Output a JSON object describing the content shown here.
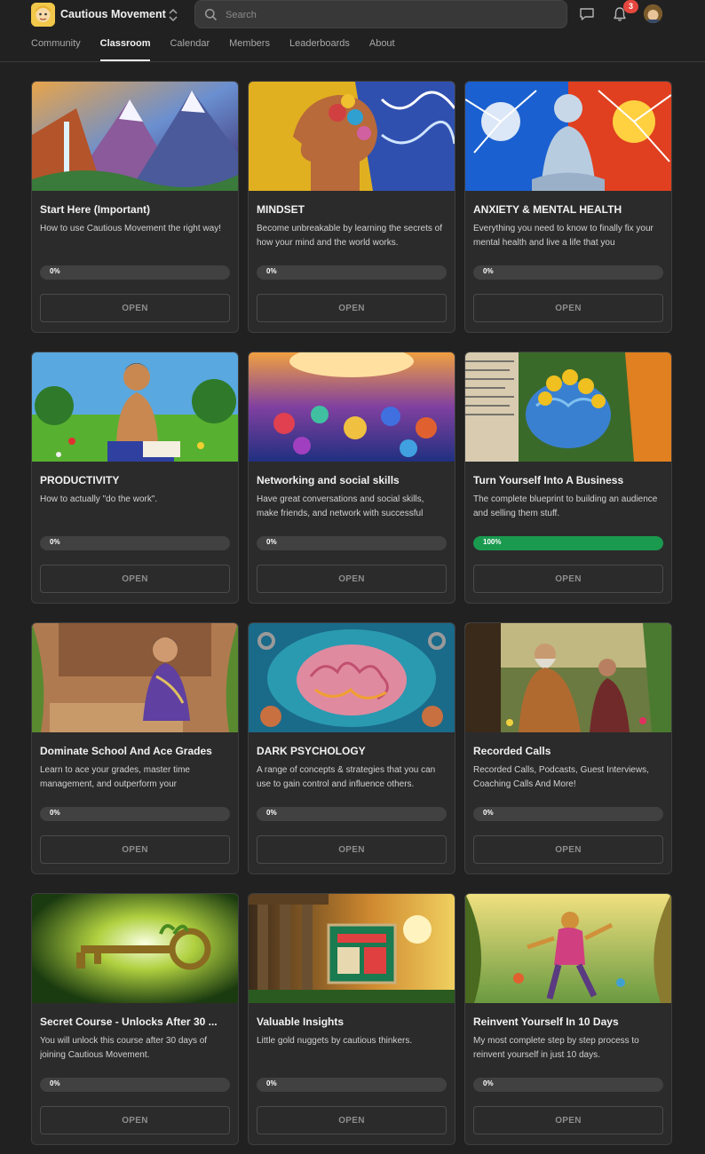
{
  "header": {
    "group_name": "Cautious Movement",
    "search_placeholder": "Search",
    "notification_count": "3"
  },
  "nav": {
    "tabs": [
      {
        "label": "Community",
        "active": false
      },
      {
        "label": "Classroom",
        "active": true
      },
      {
        "label": "Calendar",
        "active": false
      },
      {
        "label": "Members",
        "active": false
      },
      {
        "label": "Leaderboards",
        "active": false
      },
      {
        "label": "About",
        "active": false
      }
    ]
  },
  "courses": [
    {
      "title": "Start Here (Important)",
      "description": "How to use Cautious Movement the right way!",
      "progress_label": "0%",
      "progress": 0,
      "open_label": "OPEN",
      "cover": "mountains-waterfall"
    },
    {
      "title": "MINDSET",
      "description": "Become unbreakable by learning the secrets of how your mind and the world works.",
      "progress_label": "0%",
      "progress": 0,
      "open_label": "OPEN",
      "cover": "head-profile-flowers"
    },
    {
      "title": "ANXIETY & MENTAL HEALTH",
      "description": "Everything you need to know to finally fix your mental health and live a life that you",
      "progress_label": "0%",
      "progress": 0,
      "open_label": "OPEN",
      "cover": "meditating-statue"
    },
    {
      "title": "PRODUCTIVITY",
      "description": "How to actually \"do the work\".",
      "progress_label": "0%",
      "progress": 0,
      "open_label": "OPEN",
      "cover": "man-reading-field"
    },
    {
      "title": "Networking and social skills",
      "description": "Have great conversations and social skills, make friends, and network with successful",
      "progress_label": "0%",
      "progress": 0,
      "open_label": "OPEN",
      "cover": "crowd-painting"
    },
    {
      "title": "Turn Yourself Into A Business",
      "description": "The complete blueprint to building an audience and selling them stuff.",
      "progress_label": "100%",
      "progress": 1,
      "open_label": "OPEN",
      "cover": "brain-coins"
    },
    {
      "title": "Dominate School And Ace Grades",
      "description": "Learn to ace your grades, master time management, and outperform your",
      "progress_label": "0%",
      "progress": 0,
      "open_label": "OPEN",
      "cover": "student-thinking"
    },
    {
      "title": "DARK PSYCHOLOGY",
      "description": "A range of concepts & strategies that you can use to gain control and influence others.",
      "progress_label": "0%",
      "progress": 0,
      "open_label": "OPEN",
      "cover": "brain-chains"
    },
    {
      "title": "Recorded Calls",
      "description": "Recorded Calls, Podcasts, Guest Interviews, Coaching Calls And More!",
      "progress_label": "0%",
      "progress": 0,
      "open_label": "OPEN",
      "cover": "sage-conversation"
    },
    {
      "title": "Secret Course - Unlocks After 30 ...",
      "description": "You will unlock this course after 30 days of joining Cautious Movement.",
      "progress_label": "0%",
      "progress": 0,
      "open_label": "OPEN",
      "cover": "golden-key"
    },
    {
      "title": "Valuable Insights",
      "description": "Little gold nuggets by cautious thinkers.",
      "progress_label": "0%",
      "progress": 0,
      "open_label": "OPEN",
      "cover": "temple-screen-sunset"
    },
    {
      "title": "Reinvent Yourself In 10 Days",
      "description": "My most complete step by step process to reinvent yourself in just 10 days.",
      "progress_label": "0%",
      "progress": 0,
      "open_label": "OPEN",
      "cover": "runner-canyon"
    }
  ],
  "colors": {
    "background": "#212121",
    "card": "#2b2b2b",
    "progress_complete": "#1a9a4f",
    "badge": "#e5473e"
  }
}
